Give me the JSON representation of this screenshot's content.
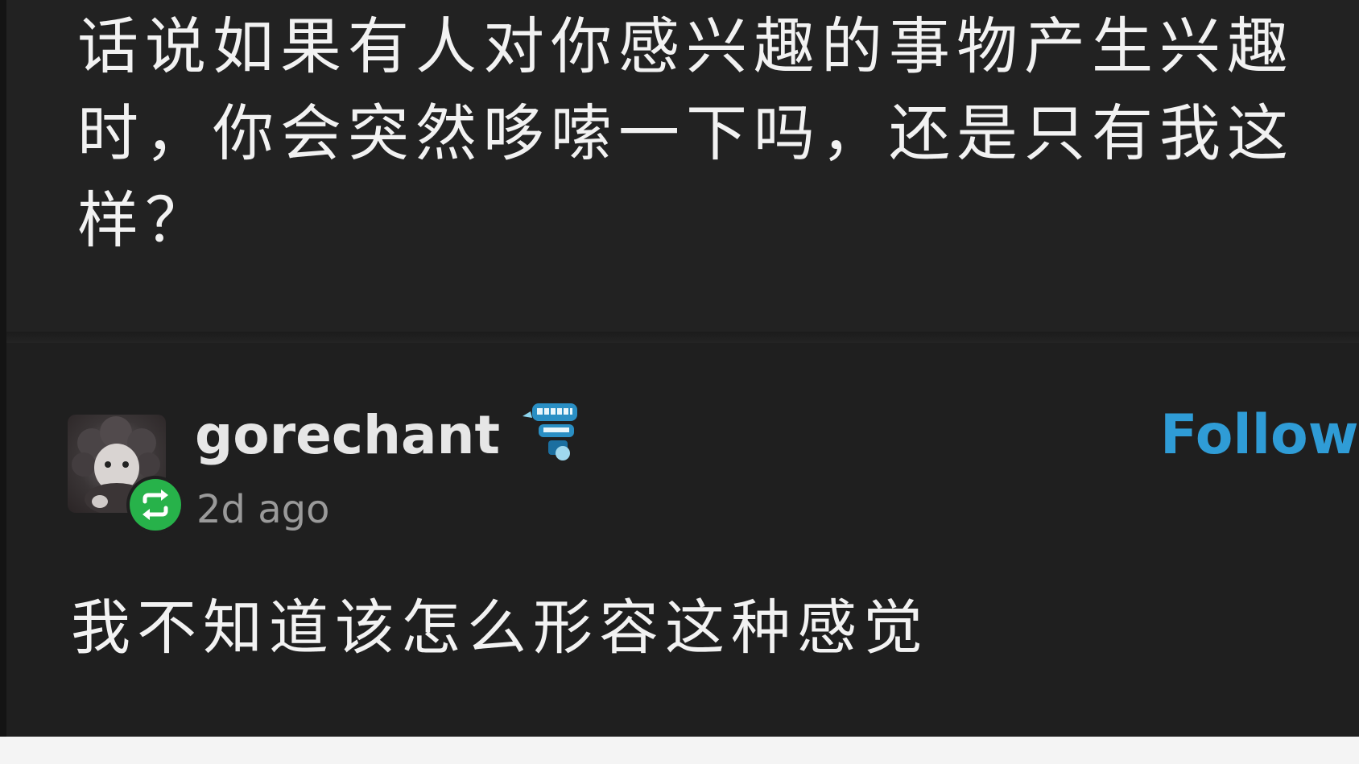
{
  "post": {
    "text": "话说如果有人对你感兴趣的事物产生兴趣时，你会突然哆嗦一下吗，还是只有我这样？"
  },
  "reblog": {
    "username": "gorechant",
    "time_ago": "2d ago",
    "follow_label": "Follow",
    "comment": "我不知道该怎么形容这种感觉",
    "badge_icon": "chattering-teeth-icon",
    "reblog_icon": "reblog-icon",
    "avatar_icon": "sheep-plush-avatar"
  },
  "colors": {
    "background": "#202020",
    "text": "#f2f2f2",
    "follow": "#2f9cd6",
    "reblog_green": "#27b24a",
    "muted": "#9a9a9a"
  }
}
